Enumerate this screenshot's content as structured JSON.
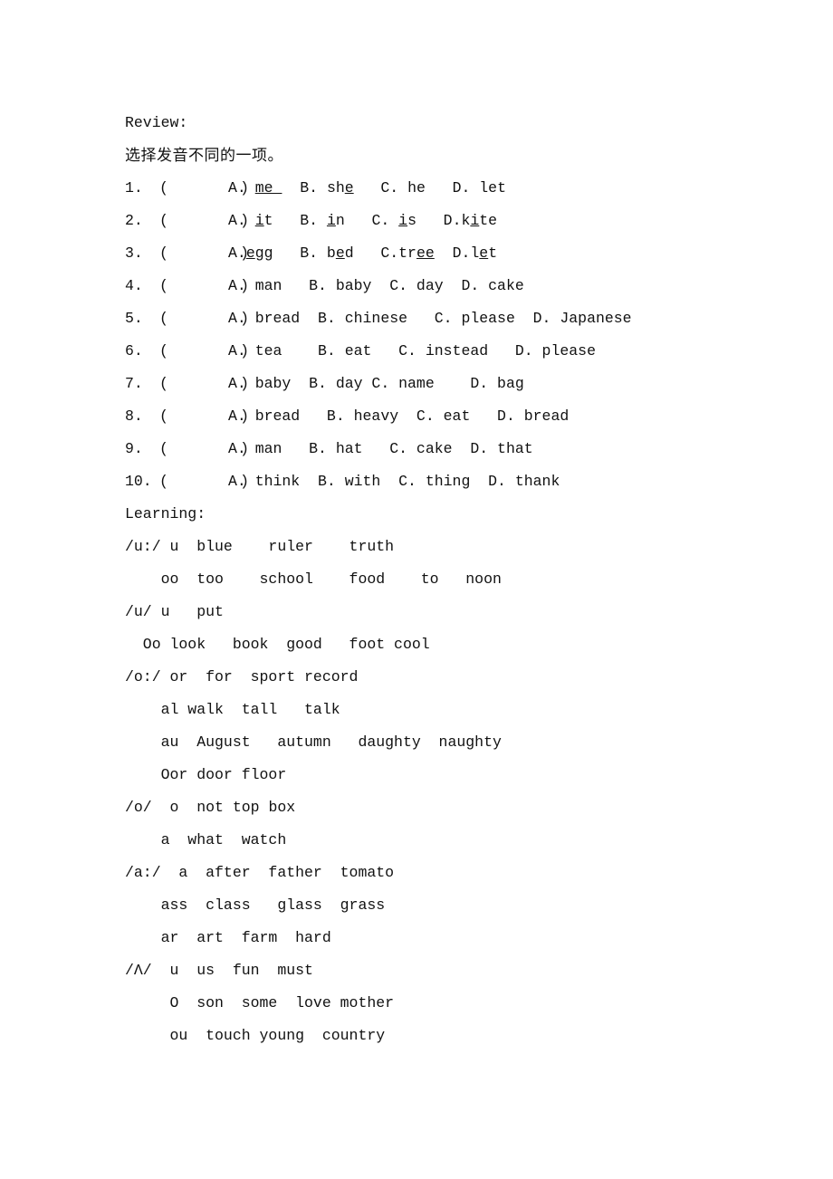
{
  "document": {
    "background_color": "#ffffff",
    "text_color": "#111111",
    "review": {
      "heading": "Review:",
      "instruction_cn": "选择发音不同的一项。",
      "questions": [
        {
          "number": "1.",
          "paren": "(        )",
          "options_html": "A. <u>me </u>  B. sh<u>e</u>   C. he   D. let"
        },
        {
          "number": "2.",
          "paren": "(        )",
          "options_html": "A. <u>i</u>t   B. <u>i</u>n   C. <u>i</u>s   D.k<u>i</u>te"
        },
        {
          "number": "3.",
          "paren": "(        )",
          "options_html": "A.<u>e</u>gg   B. b<u>e</u>d   C.tr<u>ee</u>  D.l<u>e</u>t"
        },
        {
          "number": "4.",
          "paren": "(        )",
          "options_html": "A. man   B. baby  C. day  D. cake"
        },
        {
          "number": "5.",
          "paren": "(        )",
          "options_html": "A. bread  B. chinese   C. please  D. Japanese"
        },
        {
          "number": "6.",
          "paren": "(        )",
          "options_html": "A. tea    B. eat   C. instead   D. please"
        },
        {
          "number": "7.",
          "paren": "(        )",
          "options_html": "A. baby  B. day C. name    D. bag"
        },
        {
          "number": "8.",
          "paren": "(        )",
          "options_html": "A. bread   B. heavy  C. eat   D. bread"
        },
        {
          "number": "9.",
          "paren": "(        )",
          "options_html": "A. man   B. hat   C. cake  D. that"
        },
        {
          "number": "10.",
          "paren": "(        )",
          "options_html": "A. think  B. with  C. thing  D. thank"
        }
      ]
    },
    "learning": {
      "heading": "Learning:",
      "rows": [
        {
          "symbol": "/u:/",
          "indent": 0,
          "words": " u  blue    ruler    truth"
        },
        {
          "symbol": "",
          "indent": 1,
          "words": "    oo  too    school    food    to   noon"
        },
        {
          "symbol": "/u/",
          "indent": 0,
          "words": " u   put"
        },
        {
          "symbol": "",
          "indent": 1,
          "words": "  Oo look   book  good   foot cool"
        },
        {
          "symbol": "/o:/",
          "indent": 0,
          "words": " or  for  sport record"
        },
        {
          "symbol": "",
          "indent": 1,
          "words": "    al walk  tall   talk"
        },
        {
          "symbol": "",
          "indent": 1,
          "words": "    au  August   autumn   daughty  naughty"
        },
        {
          "symbol": "",
          "indent": 1,
          "words": "    Oor door floor"
        },
        {
          "symbol": "/o/",
          "indent": 0,
          "words": "  o  not top box"
        },
        {
          "symbol": "",
          "indent": 1,
          "words": "    a  what  watch"
        },
        {
          "symbol": "/a:/",
          "indent": 0,
          "words": "  a  after  father  tomato"
        },
        {
          "symbol": "",
          "indent": 1,
          "words": "    ass  class   glass  grass"
        },
        {
          "symbol": "",
          "indent": 1,
          "words": "    ar  art  farm  hard"
        },
        {
          "symbol": "/Λ/",
          "indent": 0,
          "words": "  u  us  fun  must"
        },
        {
          "symbol": "",
          "indent": 1,
          "words": "     O  son  some  love mother"
        },
        {
          "symbol": "",
          "indent": 1,
          "words": "     ou  touch young  country"
        }
      ]
    }
  }
}
